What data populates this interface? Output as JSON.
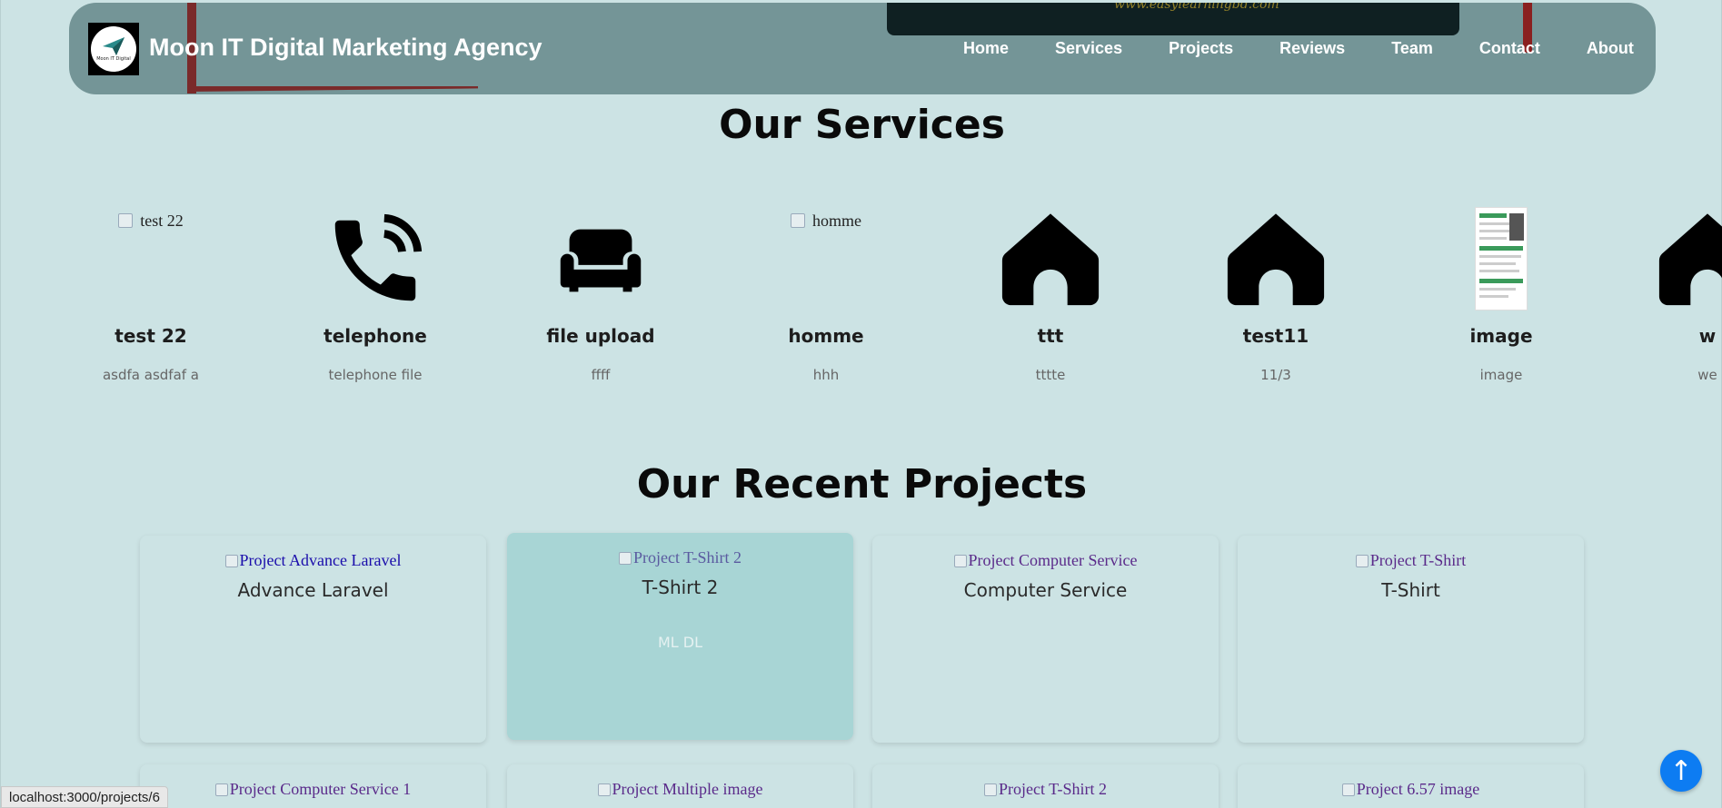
{
  "brand": {
    "name": "Moon IT Digital Marketing Agency",
    "logo_text": "Moon IT Digital",
    "bg_text": "www.easylearningbd.com"
  },
  "nav": [
    "Home",
    "Services",
    "Projects",
    "Reviews",
    "Team",
    "Contact",
    "About"
  ],
  "services": {
    "title": "Our Services",
    "items": [
      {
        "name": "test 22",
        "desc": "asdfa asdfaf a",
        "icon": "broken-image",
        "alt": "test 22"
      },
      {
        "name": "telephone",
        "desc": "telephone file",
        "icon": "phone-icon"
      },
      {
        "name": "file upload",
        "desc": "ffff",
        "icon": "couch-icon"
      },
      {
        "name": "homme",
        "desc": "hhh",
        "icon": "broken-image",
        "alt": "homme"
      },
      {
        "name": "ttt",
        "desc": "tttte",
        "icon": "home-icon"
      },
      {
        "name": "test11",
        "desc": "11/3",
        "icon": "home-icon"
      },
      {
        "name": "image",
        "desc": "image",
        "icon": "document-thumbnail"
      },
      {
        "name": "w",
        "desc": "we",
        "icon": "home-icon"
      }
    ]
  },
  "projects": {
    "title": "Our Recent Projects",
    "items": [
      {
        "alt": "Project Advance Laravel",
        "title": "Advance Laravel",
        "desc": ""
      },
      {
        "alt": "Project T-Shirt 2",
        "title": "T-Shirt 2",
        "desc": "ML DL"
      },
      {
        "alt": "Project Computer Service",
        "title": "Computer Service",
        "desc": ""
      },
      {
        "alt": "Project T-Shirt",
        "title": "T-Shirt",
        "desc": ""
      },
      {
        "alt": "Project Computer Service 1",
        "title": "",
        "desc": ""
      },
      {
        "alt": "Project Multiple image",
        "title": "",
        "desc": ""
      },
      {
        "alt": "Project T-Shirt 2",
        "title": "",
        "desc": ""
      },
      {
        "alt": "Project 6.57 image",
        "title": "",
        "desc": ""
      }
    ]
  },
  "status_url": "localhost:3000/projects/6",
  "scroll_top_symbol": "↑",
  "colors": {
    "page_bg": "#cce3e4",
    "header_bg": "#749597",
    "active_card": "#a8d5d5",
    "scroll_button": "#0d7cf2",
    "link_blue": "#1a0dab",
    "link_visited": "#5a2a8a"
  }
}
